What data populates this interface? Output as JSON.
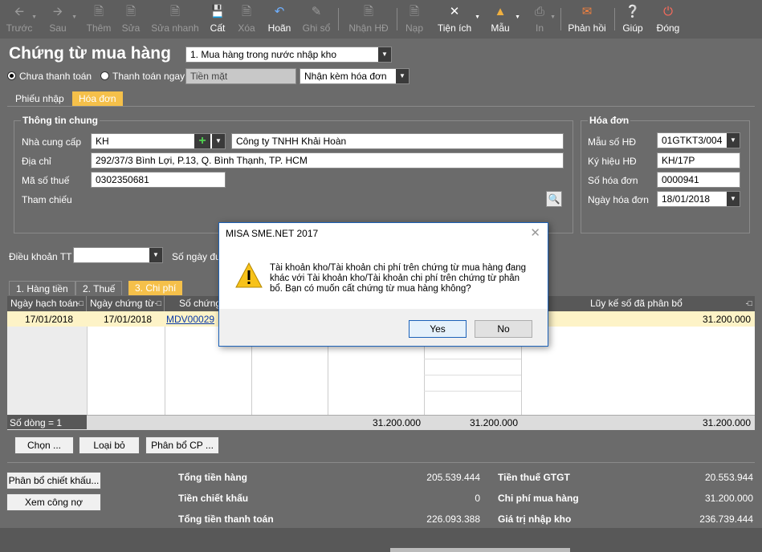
{
  "toolbar": [
    {
      "label": "Trước",
      "icon": "arrow-left-icon",
      "enabled": false
    },
    {
      "label": "Sau",
      "icon": "arrow-right-icon",
      "enabled": false
    },
    {
      "label": "Thêm",
      "icon": "new-document-icon",
      "enabled": false
    },
    {
      "label": "Sửa",
      "icon": "edit-document-icon",
      "enabled": false
    },
    {
      "label": "Sửa nhanh",
      "icon": "quick-edit-icon",
      "enabled": false
    },
    {
      "label": "Cất",
      "icon": "save-icon",
      "enabled": true
    },
    {
      "label": "Xóa",
      "icon": "delete-icon",
      "enabled": false
    },
    {
      "label": "Hoãn",
      "icon": "undo-icon",
      "enabled": true
    },
    {
      "label": "Ghi sổ",
      "icon": "pencil-icon",
      "enabled": false
    },
    {
      "label": "Nhận HĐ",
      "icon": "receive-invoice-icon",
      "enabled": false
    },
    {
      "label": "Nạp",
      "icon": "load-icon",
      "enabled": false
    },
    {
      "label": "Tiện ích",
      "icon": "tools-icon",
      "enabled": true
    },
    {
      "label": "Mẫu",
      "icon": "template-icon",
      "enabled": true
    },
    {
      "label": "In",
      "icon": "print-icon",
      "enabled": false
    },
    {
      "label": "Phản hồi",
      "icon": "mail-icon",
      "enabled": true
    },
    {
      "label": "Giúp",
      "icon": "help-icon",
      "enabled": true
    },
    {
      "label": "Đóng",
      "icon": "power-icon",
      "enabled": true
    }
  ],
  "header": {
    "title": "Chứng từ mua hàng",
    "type_select": "1. Mua hàng trong nước nhập kho",
    "radio_unpaid": "Chưa thanh toán",
    "radio_paid": "Thanh toán ngay",
    "payment_method": "Tiền mặt",
    "invoice_option": "Nhận kèm hóa đơn"
  },
  "top_tabs": [
    "Phiếu nhập",
    "Hóa đơn"
  ],
  "general": {
    "group_title": "Thông tin chung",
    "supplier_label": "Nhà cung cấp",
    "supplier_code": "KH",
    "supplier_name": "Công ty TNHH Khải Hoàn",
    "address_label": "Địa chỉ",
    "address": "292/37/3 Bình Lợi, P.13, Q. Bình Thạnh, TP. HCM",
    "tax_label": "Mã số thuế",
    "tax": "0302350681",
    "ref_label": "Tham chiếu"
  },
  "invoice": {
    "group_title": "Hóa đơn",
    "form_label": "Mẫu số HĐ",
    "form": "01GTKT3/004",
    "symbol_label": "Ký hiệu HĐ",
    "symbol": "KH/17P",
    "number_label": "Số hóa đơn",
    "number": "0000941",
    "date_label": "Ngày hóa đơn",
    "date": "18/01/2018"
  },
  "terms": {
    "label": "Điều khoản TT",
    "days_label": "Số ngày đượ"
  },
  "detail_tabs": [
    "1. Hàng tiền",
    "2. Thuế",
    "3. Chi phí"
  ],
  "grid": {
    "headers": [
      "Ngày hạch toán",
      "Ngày chứng từ",
      "Số chứng",
      "Lũy kế số đã phân bổ"
    ],
    "row": {
      "date1": "17/01/2018",
      "date2": "17/01/2018",
      "doc": "MDV00029",
      "total": "31.200.000"
    },
    "footer": {
      "count": "Số dòng = 1",
      "v1": "31.200.000",
      "v2": "31.200.000",
      "v3": "31.200.000"
    }
  },
  "grid_buttons": [
    "Chọn ...",
    "Loại bỏ",
    "Phân bổ CP ..."
  ],
  "side_buttons": [
    "Phân bổ chiết khấu...",
    "Xem công nợ"
  ],
  "totals": [
    {
      "label": "Tổng tiền hàng",
      "value": "205.539.444"
    },
    {
      "label": "Tiền chiết khấu",
      "value": "0"
    },
    {
      "label": "Tổng tiền thanh toán",
      "value": "226.093.388"
    },
    {
      "label": "Tiền thuế GTGT",
      "value": "20.553.944"
    },
    {
      "label": "Chi phí mua hàng",
      "value": "31.200.000"
    },
    {
      "label": "Giá trị nhập kho",
      "value": "236.739.444"
    }
  ],
  "dialog": {
    "title": "MISA SME.NET 2017",
    "message": "Tài khoản kho/Tài khoản chi phí trên chứng từ mua hàng đang khác với Tài khoản kho/Tài khoản chi phí trên chứng từ phân bổ. Bạn có muốn cất chứng từ mua hàng không?",
    "yes": "Yes",
    "no": "No"
  },
  "colors": {
    "background": "#6b6b6b",
    "active_tab": "#f5c04a",
    "dialog_border": "#1c62b9",
    "row_highlight": "#fdf3c7"
  }
}
